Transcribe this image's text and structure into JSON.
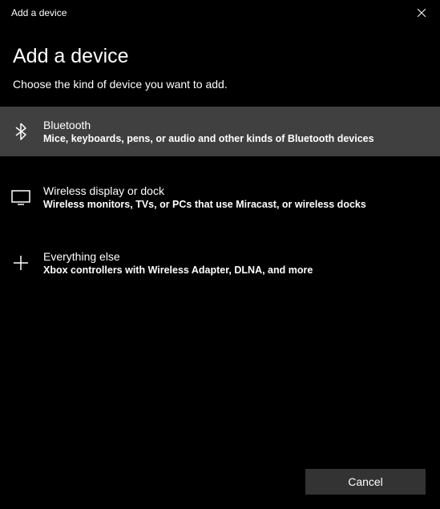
{
  "titlebar": {
    "title": "Add a device"
  },
  "heading": "Add a device",
  "subheading": "Choose the kind of device you want to add.",
  "options": [
    {
      "title": "Bluetooth",
      "desc": "Mice, keyboards, pens, or audio and other kinds of Bluetooth devices",
      "selected": true
    },
    {
      "title": "Wireless display or dock",
      "desc": "Wireless monitors, TVs, or PCs that use Miracast, or wireless docks",
      "selected": false
    },
    {
      "title": "Everything else",
      "desc": "Xbox controllers with Wireless Adapter, DLNA, and more",
      "selected": false
    }
  ],
  "footer": {
    "cancel": "Cancel"
  }
}
